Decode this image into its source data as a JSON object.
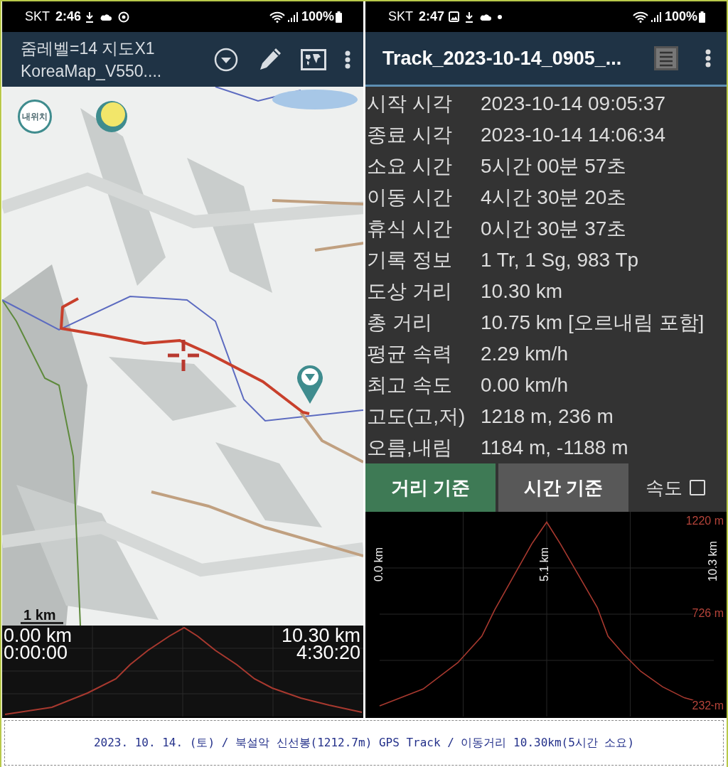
{
  "left_phone": {
    "status_bar": {
      "carrier": "SKT",
      "time": "2:46",
      "battery": "100%"
    },
    "app_bar": {
      "title_line_1": "줌레벨=14 지도X1",
      "title_line_2": "KoreaMap_V550...."
    },
    "map": {
      "my_location_button": "내위치",
      "scale": "1 km"
    },
    "profile": {
      "start_distance": "0.00 km",
      "start_time": "0:00:00",
      "end_distance": "10.30 km",
      "end_time": "4:30:20"
    }
  },
  "right_phone": {
    "status_bar": {
      "carrier": "SKT",
      "time": "2:47",
      "battery": "100%"
    },
    "app_bar": {
      "title": "Track_2023-10-14_0905_..."
    },
    "stats": [
      {
        "label": "시작 시각",
        "value": "2023-10-14 09:05:37"
      },
      {
        "label": "종료 시각",
        "value": "2023-10-14 14:06:34"
      },
      {
        "label": "소요 시간",
        "value": "5시간 00분 57초"
      },
      {
        "label": "이동 시간",
        "value": "4시간 30분 20초"
      },
      {
        "label": "휴식 시간",
        "value": "0시간 30분 37초"
      },
      {
        "label": "기록 정보",
        "value": "1 Tr, 1 Sg, 983 Tp"
      },
      {
        "label": "도상 거리",
        "value": "10.30 km"
      },
      {
        "label": "총 거리",
        "value": "10.75 km [오르내림 포함]"
      },
      {
        "label": "평균 속력",
        "value": "2.29 km/h"
      },
      {
        "label": "최고 속도",
        "value": "0.00 km/h"
      },
      {
        "label": "고도(고,저)",
        "value": "1218 m, 236 m"
      },
      {
        "label": "오름,내림",
        "value": "1184 m, -1188 m"
      }
    ],
    "modes": [
      {
        "label": "거리 기준",
        "selected": true
      },
      {
        "label": "시간 기준",
        "selected": false
      }
    ],
    "speed_toggle": {
      "label": "속도",
      "checked": false
    },
    "profile": {
      "chart_data": {
        "type": "line",
        "x": [
          0,
          1.34,
          2.41,
          3.15,
          3.55,
          4.16,
          4.69,
          5.15,
          5.57,
          6.24,
          6.71,
          7.04,
          7.51,
          8.05,
          8.72,
          9.39,
          10.3
        ],
        "series": [
          {
            "color": "#a8392f",
            "values": [
              236,
              326,
              467,
              608,
              750,
              938,
              1102,
              1218,
              1102,
              902,
              761,
              608,
              514,
              420,
              338,
              279,
              236
            ]
          }
        ],
        "xlim": [
          0,
          10.3
        ],
        "ylim": [
          232,
          1220
        ],
        "xticks": [
          {
            "value": 0,
            "label": "0.0 km"
          },
          {
            "value": 5.1,
            "label": "5.1 km"
          },
          {
            "value": 10.3,
            "label": "10.3 km"
          }
        ],
        "yticks": [
          {
            "value": 232,
            "label": "232 m"
          },
          {
            "value": 726,
            "label": "726 m"
          },
          {
            "value": 1220,
            "label": "1220 m"
          }
        ]
      }
    }
  },
  "caption": "2023. 10. 14. (토) / 북설악 신선봉(1212.7m) GPS Track / 이동거리 10.30km(5시간 소요)"
}
